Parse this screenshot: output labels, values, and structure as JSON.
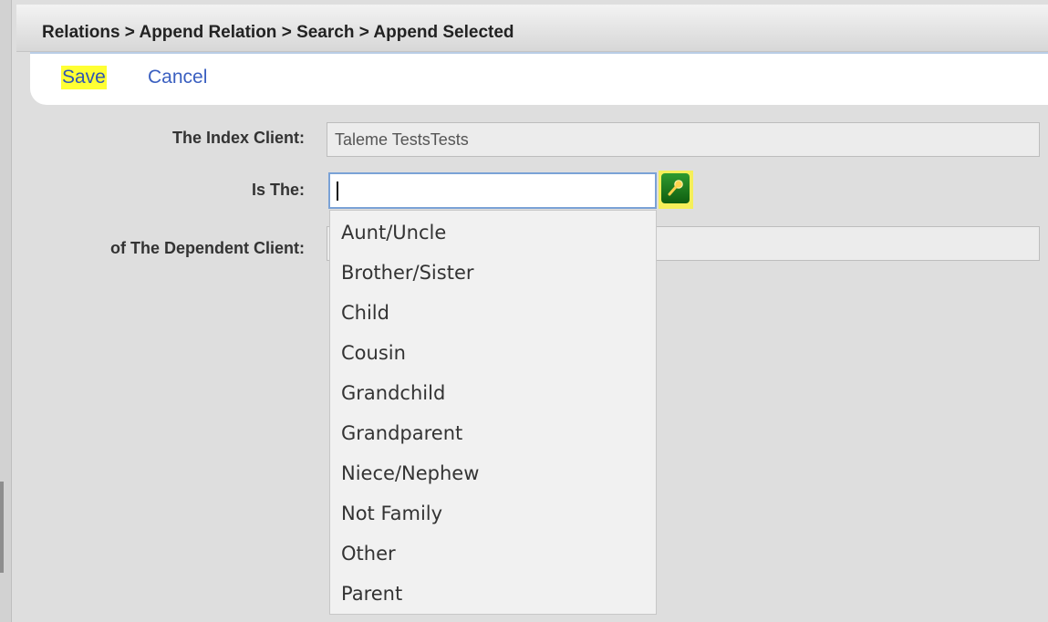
{
  "header": {
    "breadcrumb": "Relations > Append Relation > Search > Append Selected"
  },
  "toolbar": {
    "save_label": "Save",
    "cancel_label": "Cancel"
  },
  "form": {
    "index_client": {
      "label": "The Index Client:",
      "value": "Taleme TestsTests"
    },
    "is_the": {
      "label": "Is The:",
      "value": ""
    },
    "dependent_client": {
      "label": "of The Dependent Client:",
      "value": ""
    }
  },
  "dropdown": {
    "options": [
      "Aunt/Uncle",
      "Brother/Sister",
      "Child",
      "Cousin",
      "Grandchild",
      "Grandparent",
      "Niece/Nephew",
      "Not Family",
      "Other",
      "Parent"
    ]
  },
  "colors": {
    "save_highlight": "#ffff33",
    "link": "#3a5fc0",
    "lookup_button": "#1f7f1f"
  },
  "icons": {
    "lookup": "lookup-pin-icon"
  }
}
